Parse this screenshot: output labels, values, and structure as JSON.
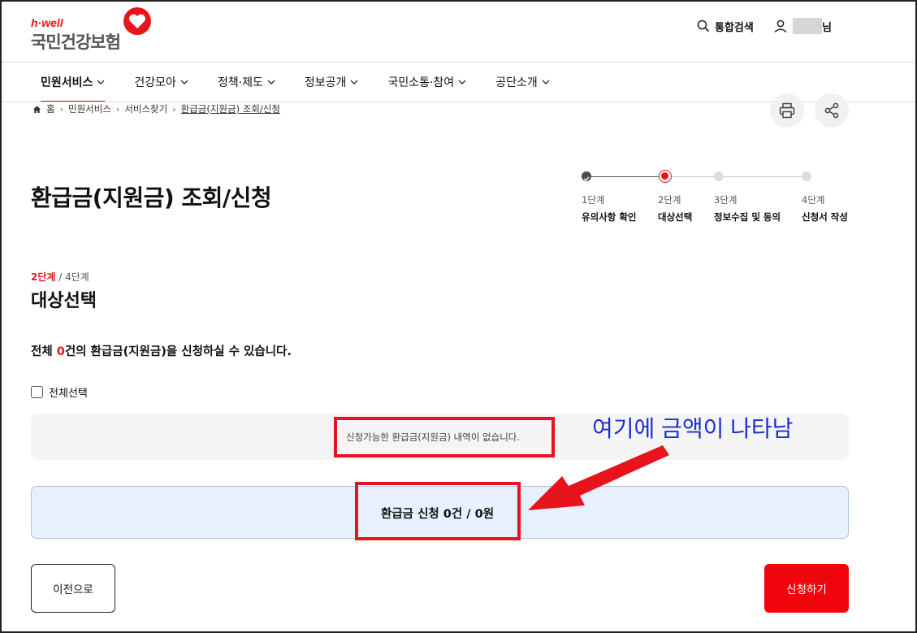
{
  "header": {
    "logo_sub": "h·well",
    "logo_main": "국민건강보험",
    "search_label": "통합검색",
    "user_suffix": "님"
  },
  "nav": {
    "items": [
      {
        "label": "민원서비스",
        "active": true
      },
      {
        "label": "건강모아"
      },
      {
        "label": "정책·제도"
      },
      {
        "label": "정보공개"
      },
      {
        "label": "국민소통·참여"
      },
      {
        "label": "공단소개"
      }
    ]
  },
  "breadcrumb": [
    "홈",
    "민원서비스",
    "서비스찾기",
    "환급금(지원금) 조회/신청"
  ],
  "page_title": "환급금(지원금) 조회/신청",
  "steps": [
    {
      "num": "1단계",
      "label": "유의사항 확인",
      "state": "done"
    },
    {
      "num": "2단계",
      "label": "대상선택",
      "state": "current"
    },
    {
      "num": "3단계",
      "label": "정보수집 및 동의",
      "state": "todo"
    },
    {
      "num": "4단계",
      "label": "신청서 작성",
      "state": "todo"
    }
  ],
  "step_indicator": {
    "current": "2단계",
    "total": "/ 4단계"
  },
  "section_title": "대상선택",
  "summary": {
    "prefix": "전체 ",
    "count": "0",
    "suffix": "건의 환급금(지원금)을 신청하실 수 있습니다."
  },
  "select_all_label": "전체선택",
  "empty_message": "신청가능한 환급금(지원금) 내역이 없습니다.",
  "total_text": "환급금 신청 0건 / 0원",
  "annotation": "여기에 금액이 나타남",
  "buttons": {
    "prev": "이전으로",
    "apply": "신청하기"
  },
  "colors": {
    "accent": "#e8141c",
    "annotation": "#1d2fd6",
    "total_bg": "#e9f0fd"
  }
}
